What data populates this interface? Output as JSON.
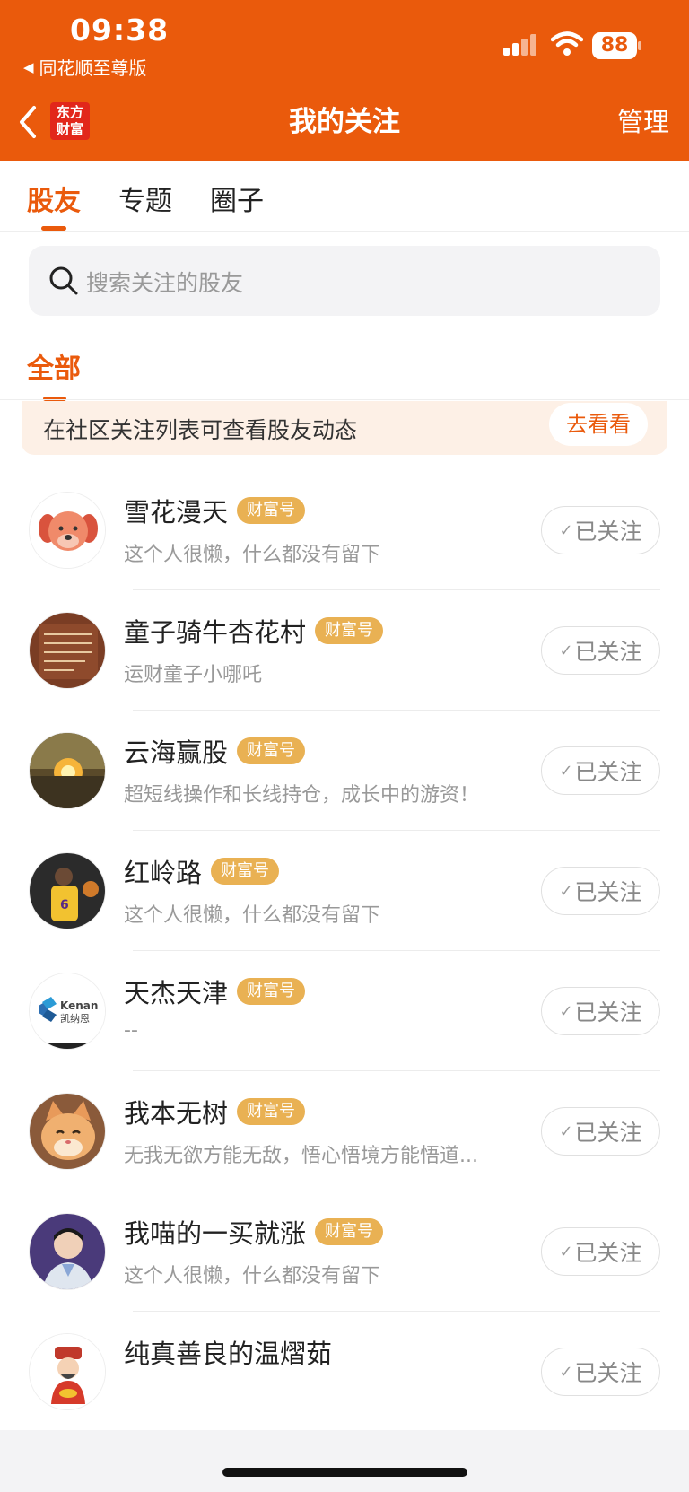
{
  "status_bar": {
    "time": "09:38",
    "back_app": "同花顺至尊版",
    "battery": "88"
  },
  "nav": {
    "logo": "东方财富",
    "logo_line1": "东方",
    "logo_line2": "财富",
    "title": "我的关注",
    "manage": "管理"
  },
  "tabs": [
    {
      "label": "股友",
      "active": true
    },
    {
      "label": "专题",
      "active": false
    },
    {
      "label": "圈子",
      "active": false
    }
  ],
  "search": {
    "placeholder": "搜索关注的股友"
  },
  "filter": {
    "label": "全部"
  },
  "banner": {
    "text": "在社区关注列表可查看股友动态",
    "button": "去看看"
  },
  "follows": [
    {
      "name": "雪花漫天",
      "badge": "财富号",
      "desc": "这个人很懒，什么都没有留下",
      "button": "已关注",
      "avatar": "dog-avatar"
    },
    {
      "name": "童子骑牛杏花村",
      "badge": "财富号",
      "desc": "运财童子小哪吒",
      "button": "已关注",
      "avatar": "book-avatar"
    },
    {
      "name": "云海赢股",
      "badge": "财富号",
      "desc": "超短线操作和长线持仓，成长中的游资！",
      "button": "已关注",
      "avatar": "sunset-avatar"
    },
    {
      "name": "红岭路",
      "badge": "财富号",
      "desc": "这个人很懒，什么都没有留下",
      "button": "已关注",
      "avatar": "basketball-avatar"
    },
    {
      "name": "天杰天津",
      "badge": "财富号",
      "desc": "--",
      "button": "已关注",
      "avatar": "kenan-logo-avatar"
    },
    {
      "name": "我本无树",
      "badge": "财富号",
      "desc": "无我无欲方能无敌，悟心悟境方能悟道...",
      "button": "已关注",
      "avatar": "cat-avatar"
    },
    {
      "name": "我喵的一买就涨",
      "badge": "财富号",
      "desc": "这个人很懒，什么都没有留下",
      "button": "已关注",
      "avatar": "man-avatar"
    },
    {
      "name": "纯真善良的温熠茹",
      "badge": "",
      "desc": "",
      "button": "已关注",
      "avatar": "fortune-god-avatar"
    }
  ],
  "avatar_texts": {
    "kenan_en": "Kenan",
    "kenan_cn": "凯纳恩"
  },
  "colors": {
    "brand": "#ea5a0c",
    "badge": "#e9b153",
    "banner_bg": "#fdf0e6"
  }
}
